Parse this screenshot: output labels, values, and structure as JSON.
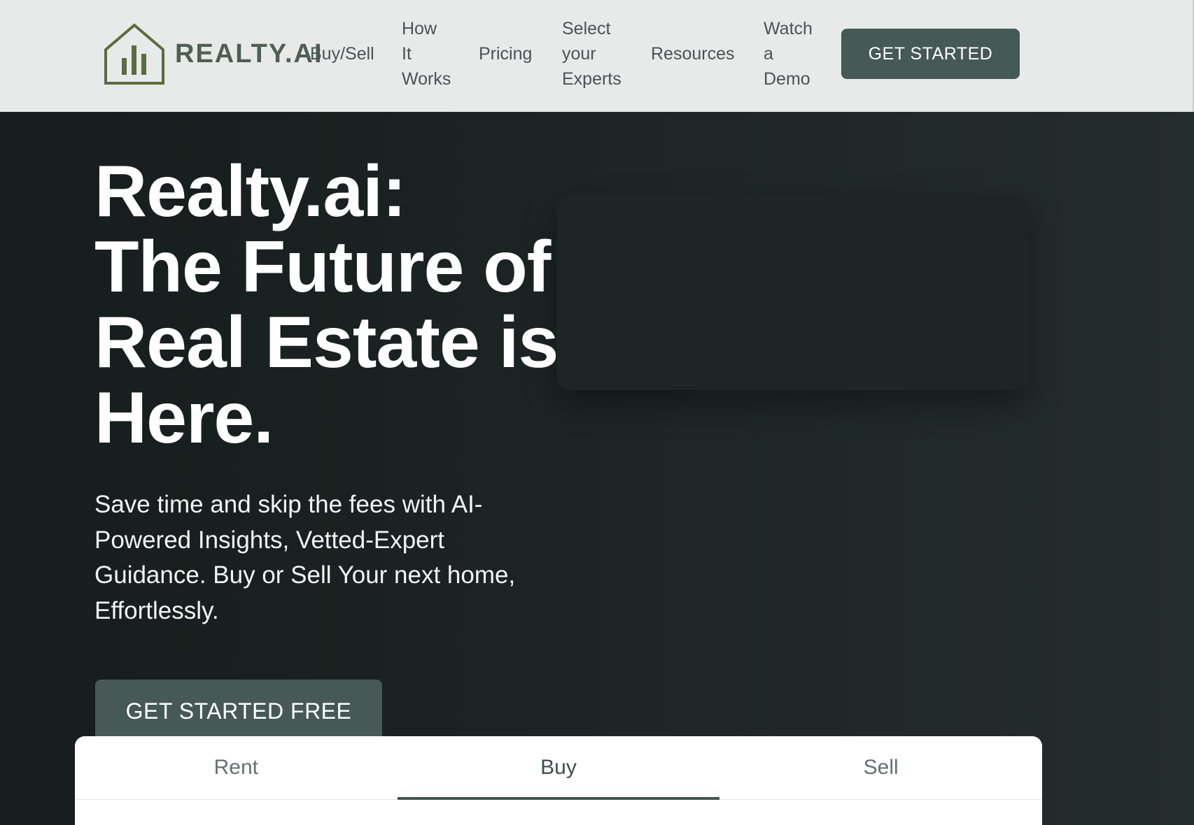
{
  "header": {
    "logo_text": "REALTY.AI",
    "nav": {
      "buy_sell": "Buy/Sell",
      "how_it_works": [
        "How",
        "It",
        "Works"
      ],
      "pricing": "Pricing",
      "select_experts": [
        "Select",
        "your",
        "Experts"
      ],
      "resources": "Resources",
      "watch_demo": [
        "Watch",
        "a",
        "Demo"
      ]
    },
    "cta_label": "GET STARTED"
  },
  "hero": {
    "title_lines": [
      "Realty.ai:",
      "The Future of",
      "Real Estate is",
      "Here."
    ],
    "subtitle_lines": [
      "Save time and skip the fees with AI-",
      "Powered Insights, Vetted-Expert",
      "Guidance. Buy or Sell Your next home,",
      "Effortlessly."
    ],
    "cta_label": "GET STARTED FREE"
  },
  "tabs": {
    "items": [
      "Rent",
      "Buy",
      "Sell"
    ],
    "active": "Buy"
  },
  "colors": {
    "header_bg": "#e8e9e9",
    "brand_green": "#4f5e56",
    "button_bg": "#455955",
    "hero_bg": "#1b2322"
  }
}
